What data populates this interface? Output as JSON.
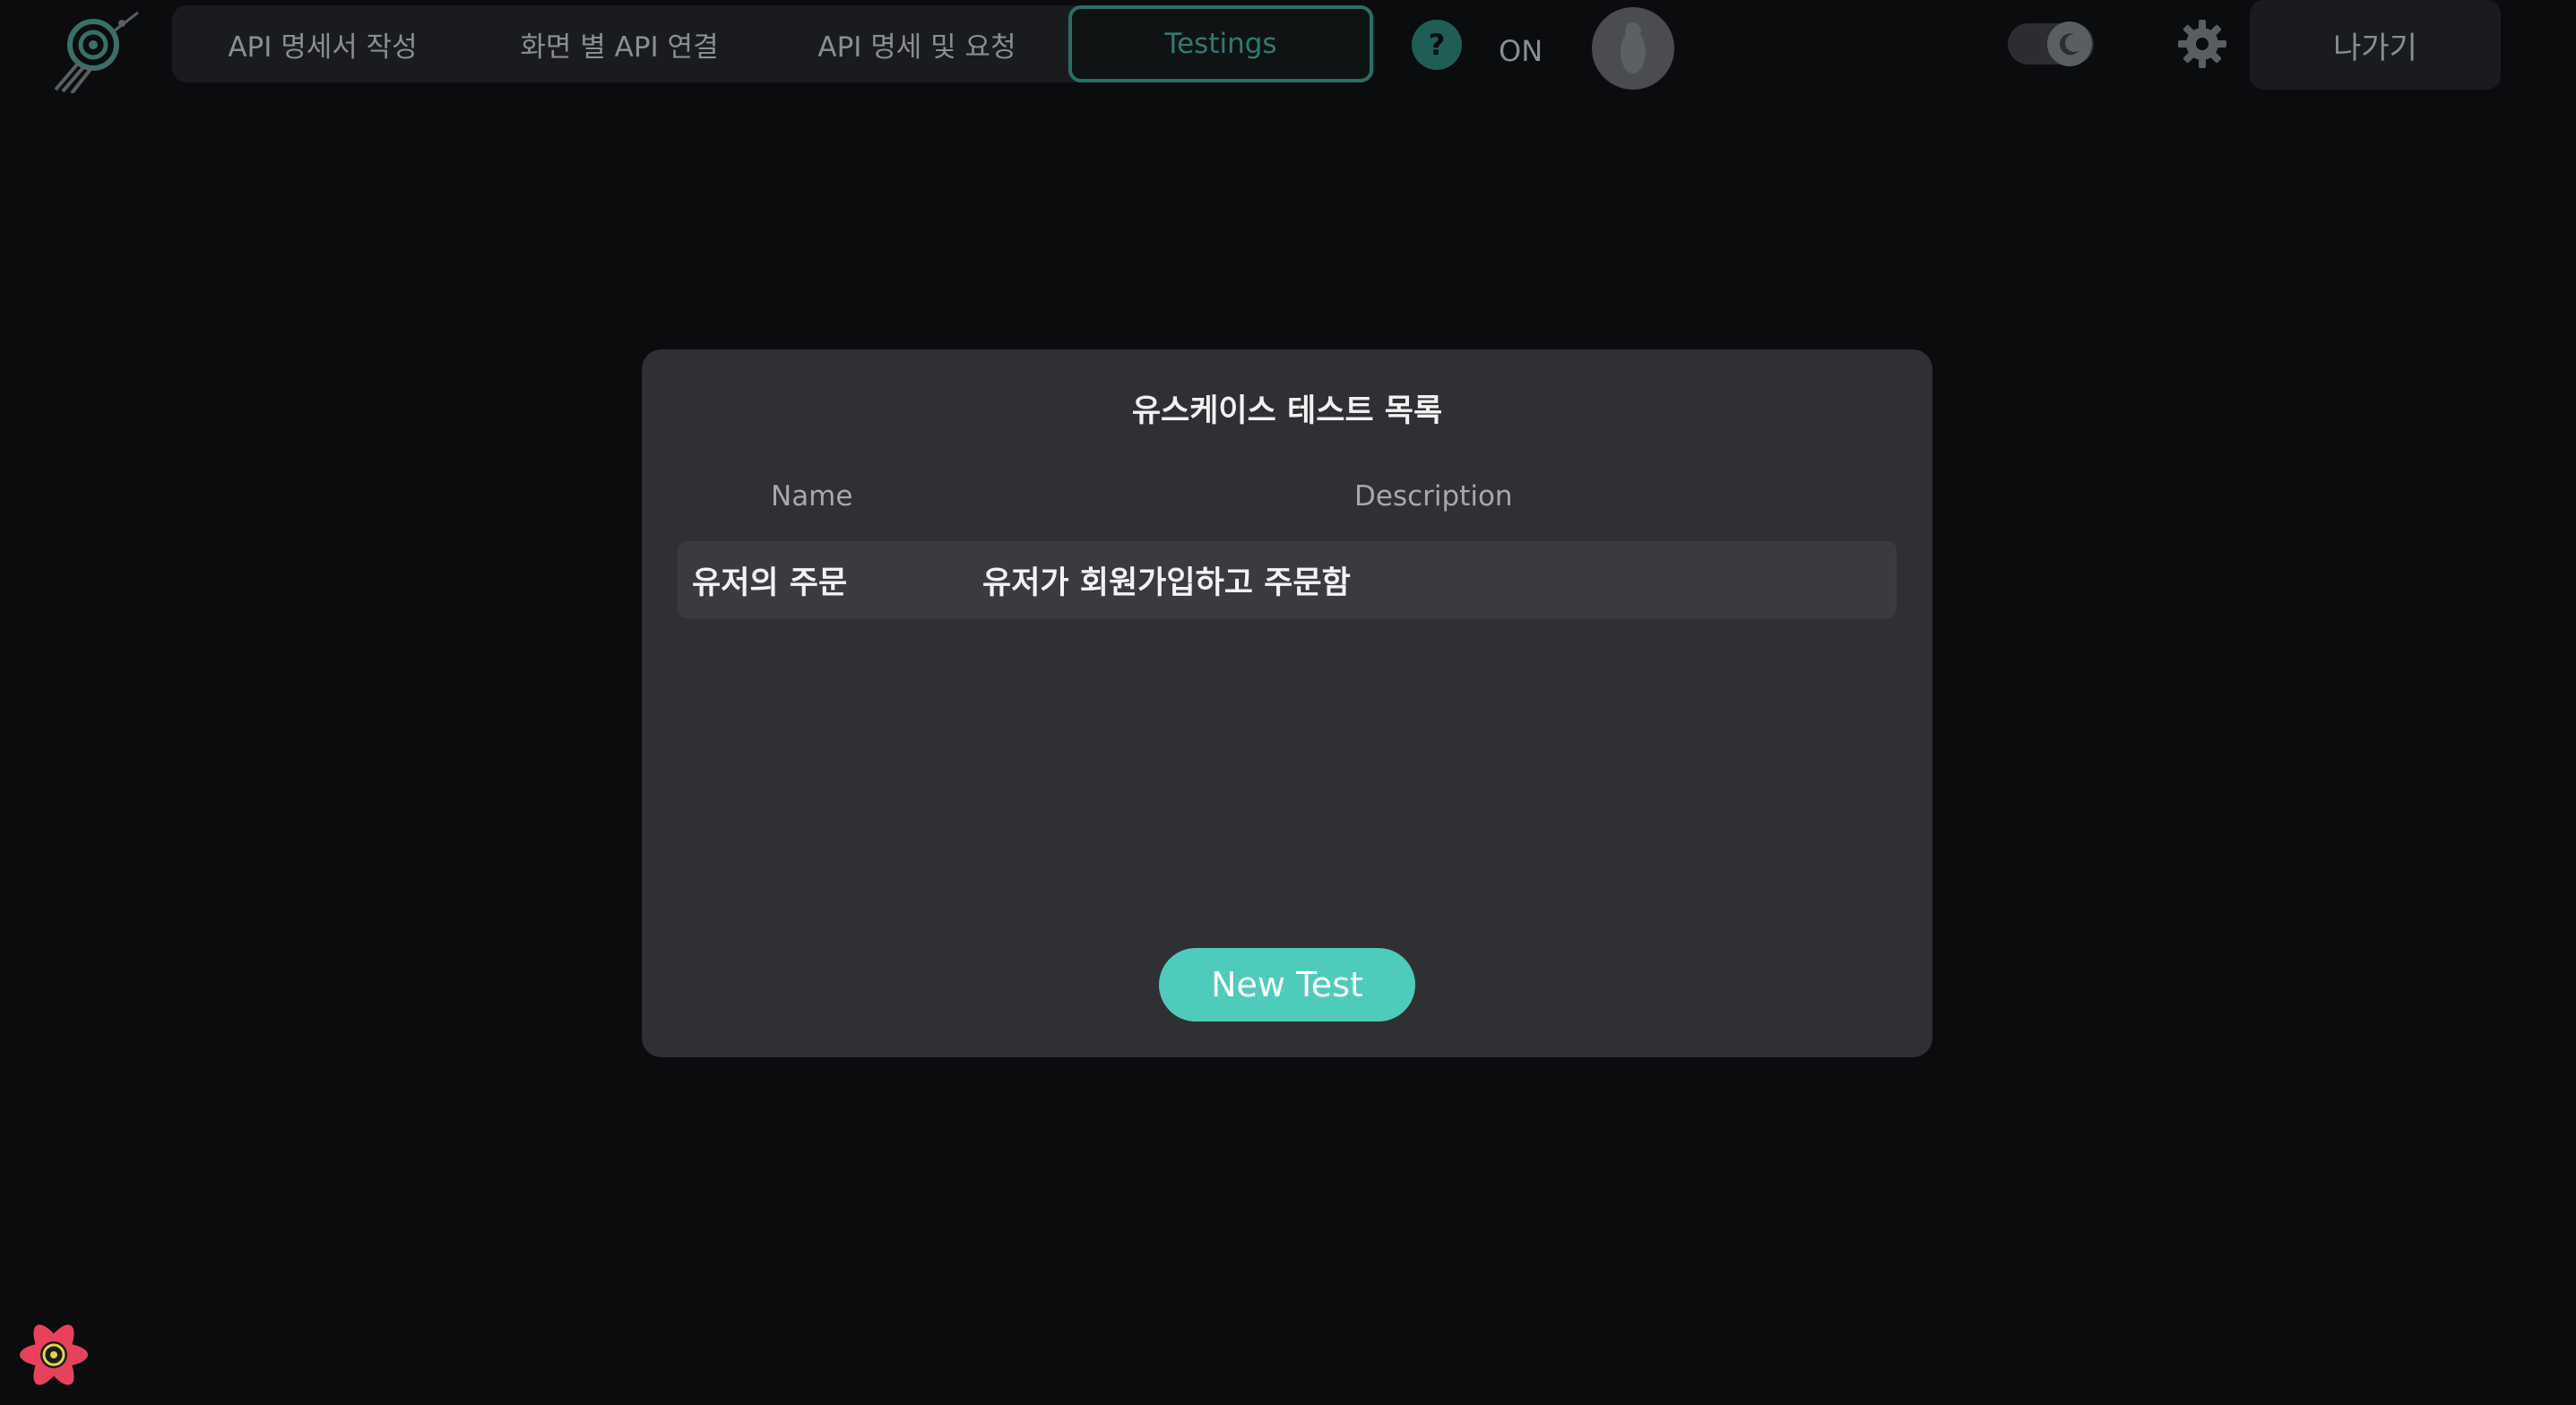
{
  "header": {
    "tabs": [
      {
        "label": "API 명세서 작성"
      },
      {
        "label": "화면 별 API 연결"
      },
      {
        "label": "API 명세 및 요청"
      },
      {
        "label": "Testings"
      }
    ],
    "active_tab": "Testings",
    "help_label": "?",
    "status_text": "ON",
    "exit_label": "나가기",
    "theme": "dark"
  },
  "modal": {
    "title": "유스케이스 테스트 목록",
    "columns": [
      "Name",
      "Description"
    ],
    "rows": [
      {
        "name": "유저의 주문",
        "description": "유저가 회원가입하고 주문함"
      }
    ],
    "new_test_label": "New Test"
  },
  "colors": {
    "background": "#0b0c0e",
    "modal": "#2f3034",
    "accent": "#4fcbbb",
    "active_tab_border": "#2a6f68"
  },
  "icons": [
    "app-logo-icon",
    "help-icon",
    "moon-icon",
    "gear-icon",
    "react-devtools-icon"
  ]
}
